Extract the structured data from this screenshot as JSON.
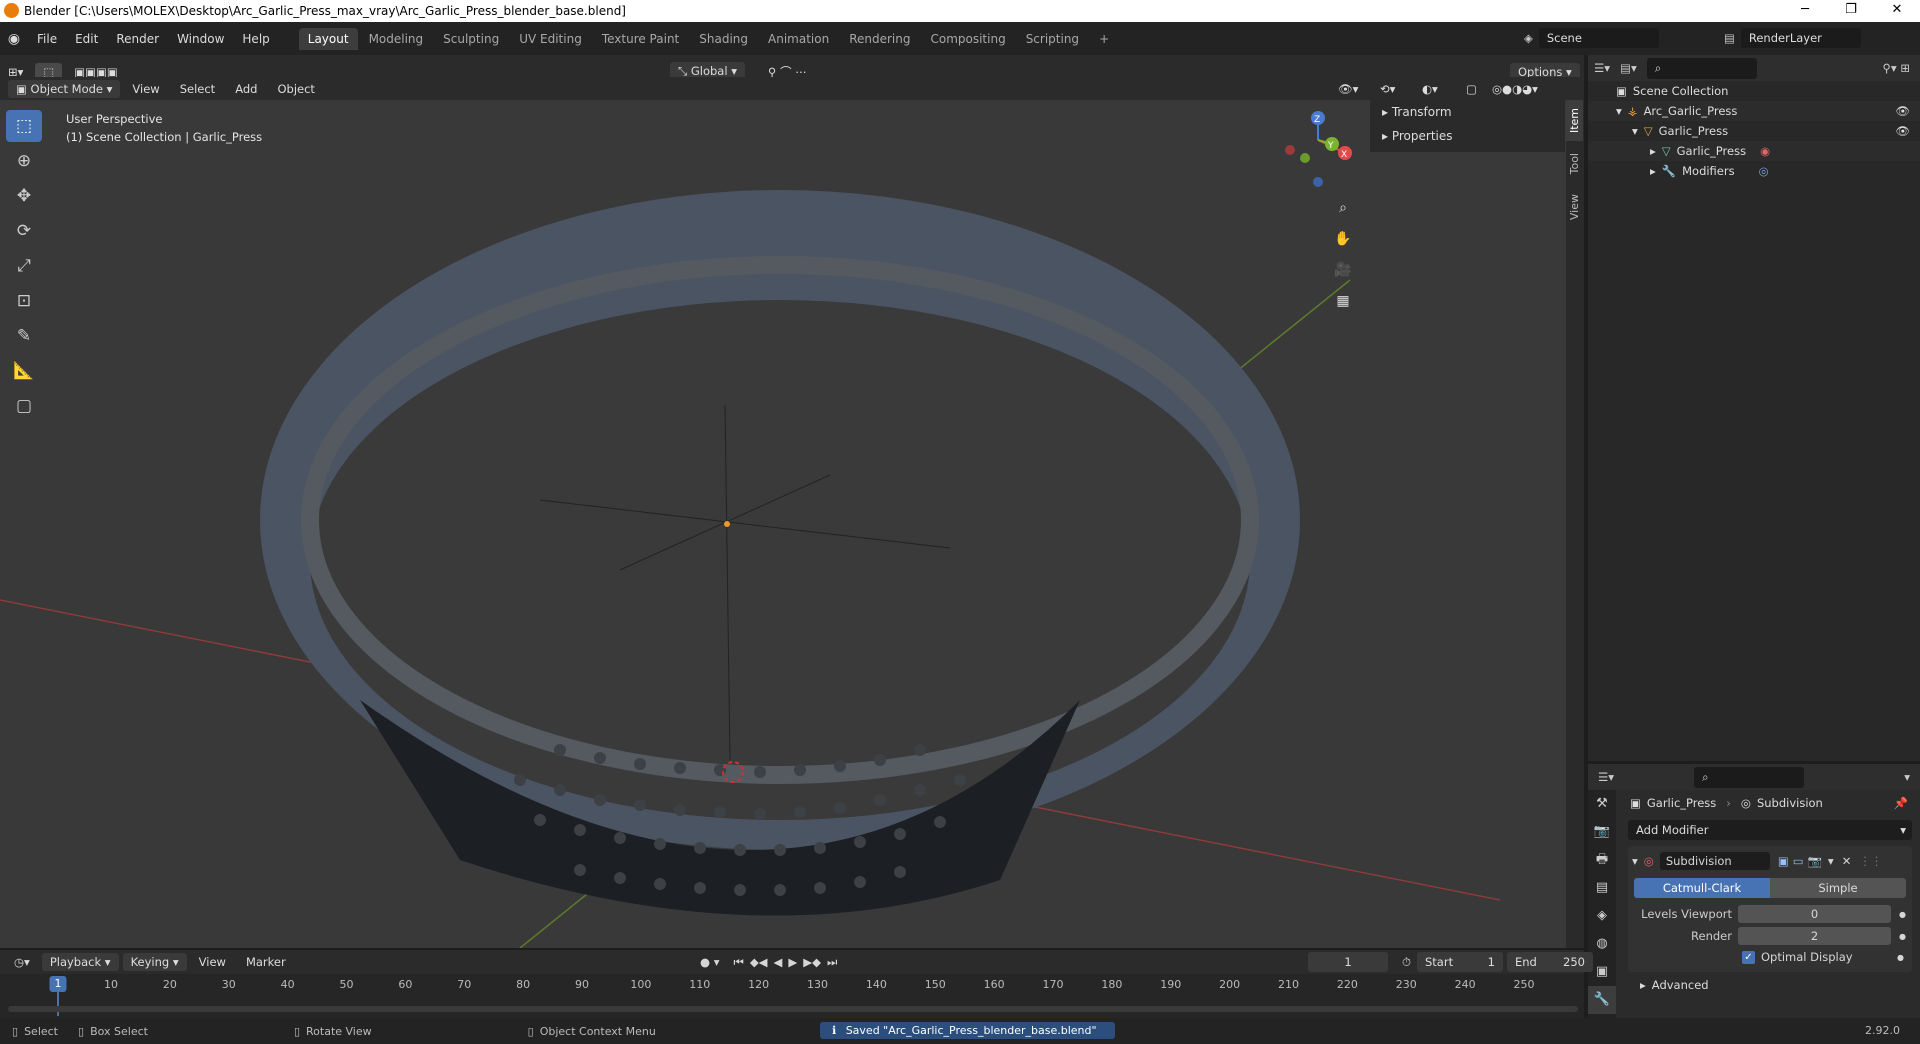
{
  "window": {
    "title": "Blender [C:\\Users\\MOLEX\\Desktop\\Arc_Garlic_Press_max_vray\\Arc_Garlic_Press_blender_base.blend]",
    "minimize": "─",
    "restore": "❐",
    "close": "✕"
  },
  "menu": [
    "File",
    "Edit",
    "Render",
    "Window",
    "Help"
  ],
  "tabs": [
    "Layout",
    "Modeling",
    "Sculpting",
    "UV Editing",
    "Texture Paint",
    "Shading",
    "Animation",
    "Rendering",
    "Compositing",
    "Scripting"
  ],
  "scene": {
    "name": "Scene",
    "layer": "RenderLayer"
  },
  "viewport": {
    "orientation": "Global",
    "options": "Options",
    "mode": "Object Mode",
    "menus": [
      "View",
      "Select",
      "Add",
      "Object"
    ],
    "overlay_title": "User Perspective",
    "overlay_sub": "(1) Scene Collection | Garlic_Press",
    "npanel": [
      "Transform",
      "Properties"
    ],
    "side_tabs": [
      "Item",
      "Tool",
      "View"
    ],
    "gizmo": {
      "x": "X",
      "y": "Y",
      "z": "Z"
    }
  },
  "outliner": {
    "root": "Scene Collection",
    "items": [
      {
        "label": "Arc_Garlic_Press",
        "indent": 1
      },
      {
        "label": "Garlic_Press",
        "indent": 2
      },
      {
        "label": "Garlic_Press",
        "indent": 3
      },
      {
        "label": "Modifiers",
        "indent": 3
      }
    ]
  },
  "properties": {
    "object": "Garlic_Press",
    "modifier": "Subdivision",
    "add_modifier": "Add Modifier",
    "mod_name": "Subdivision",
    "seg_a": "Catmull-Clark",
    "seg_b": "Simple",
    "levels_viewport_label": "Levels Viewport",
    "levels_viewport": "0",
    "render_label": "Render",
    "render": "2",
    "optimal_display": "Optimal Display",
    "advanced": "Advanced"
  },
  "timeline": {
    "menus": [
      "Playback",
      "Keying",
      "View",
      "Marker"
    ],
    "current": "1",
    "start_label": "Start",
    "start": "1",
    "end_label": "End",
    "end": "250",
    "ticks": [
      1,
      10,
      20,
      30,
      40,
      50,
      60,
      70,
      80,
      90,
      100,
      110,
      120,
      130,
      140,
      150,
      160,
      170,
      180,
      190,
      200,
      210,
      220,
      230,
      240,
      250
    ]
  },
  "status": {
    "select": "Select",
    "box_select": "Box Select",
    "rotate_view": "Rotate View",
    "context_menu": "Object Context Menu",
    "saved": "Saved \"Arc_Garlic_Press_blender_base.blend\"",
    "version": "2.92.0"
  }
}
